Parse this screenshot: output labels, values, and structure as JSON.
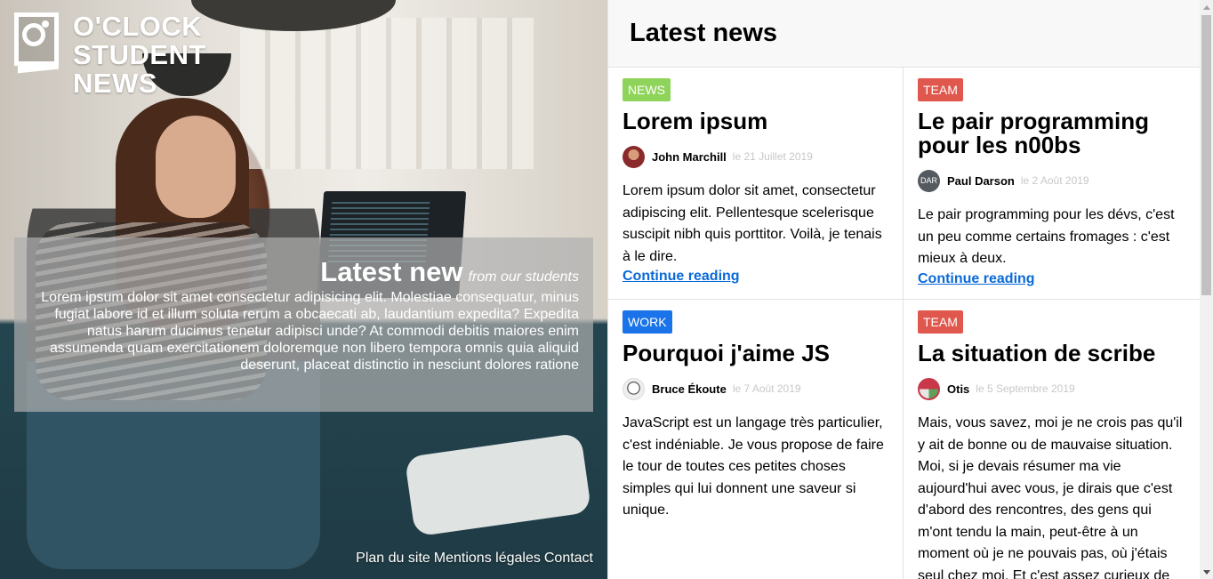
{
  "logo": {
    "line1": "O'CLOCK",
    "line2": "STUDENT",
    "line3": "NEWS"
  },
  "intro": {
    "title": "Latest new",
    "subtitle": "from our students",
    "text": "Lorem ipsum dolor sit amet consectetur adipisicing elit. Molestiae consequatur, minus fugiat labore id et illum soluta rerum a obcaecati ab, laudantium expedita? Expedita natus harum ducimus tenetur adipisci unde? At commodi debitis maiores enim assumenda quam exercitationem doloremque non libero tempora omnis quia aliquid deserunt, placeat distinctio in nesciunt dolores ratione"
  },
  "footer": {
    "links": [
      "Plan du site",
      "Mentions légales",
      "Contact"
    ]
  },
  "header": {
    "title": "Latest news"
  },
  "colors": {
    "news": "#8fd45a",
    "team": "#e0574d",
    "work": "#1a73e8",
    "link": "#0a6ad8"
  },
  "articles": [
    {
      "tag": "NEWS",
      "tag_color": "#8fd45a",
      "title": "Lorem ipsum",
      "author": "John Marchill",
      "date": "le 21 Juillet 2019",
      "avatar_icon": "avatar-photo-icon",
      "avatar_color": "#8a2a2a",
      "avatar_text": "",
      "excerpt": "Lorem ipsum dolor sit amet, consectetur adipiscing elit. Pellentesque scelerisque suscipit nibh quis porttitor. Voilà, je tenais à le dire.",
      "more": "Continue reading"
    },
    {
      "tag": "TEAM",
      "tag_color": "#e0574d",
      "title": "Le pair programming pour les n00bs",
      "author": "Paul Darson",
      "date": "le 2 Août 2019",
      "avatar_icon": "avatar-initials-icon",
      "avatar_color": "#555a60",
      "avatar_text": "DAR",
      "excerpt": "Le pair programming pour les dévs, c'est un peu comme certains fromages : c'est mieux à deux.",
      "more": "Continue reading"
    },
    {
      "tag": "WORK",
      "tag_color": "#1a73e8",
      "title": "Pourquoi j'aime JS",
      "author": "Bruce Ékoute",
      "date": "le 7 Août 2019",
      "avatar_icon": "avatar-sketch-icon",
      "avatar_color": "#e8e8e8",
      "avatar_text": "",
      "excerpt": "JavaScript est un langage très particulier, c'est indéniable. Je vous propose de faire le tour de toutes ces petites choses simples qui lui donnent une saveur si unique.",
      "more": ""
    },
    {
      "tag": "TEAM",
      "tag_color": "#e0574d",
      "title": "La situation de scribe",
      "author": "Otis",
      "date": "le 5 Septembre 2019",
      "avatar_icon": "avatar-swirl-icon",
      "avatar_color": "#c8384a",
      "avatar_text": "",
      "excerpt": "Mais, vous savez, moi je ne crois pas qu'il y ait de bonne ou de mauvaise situation. Moi, si je devais résumer ma vie aujourd'hui avec vous, je dirais que c'est d'abord des rencontres, des gens qui m'ont tendu la main, peut-être à un moment où je ne pouvais pas, où j'étais seul chez moi. Et c'est assez curieux de",
      "more": ""
    }
  ]
}
